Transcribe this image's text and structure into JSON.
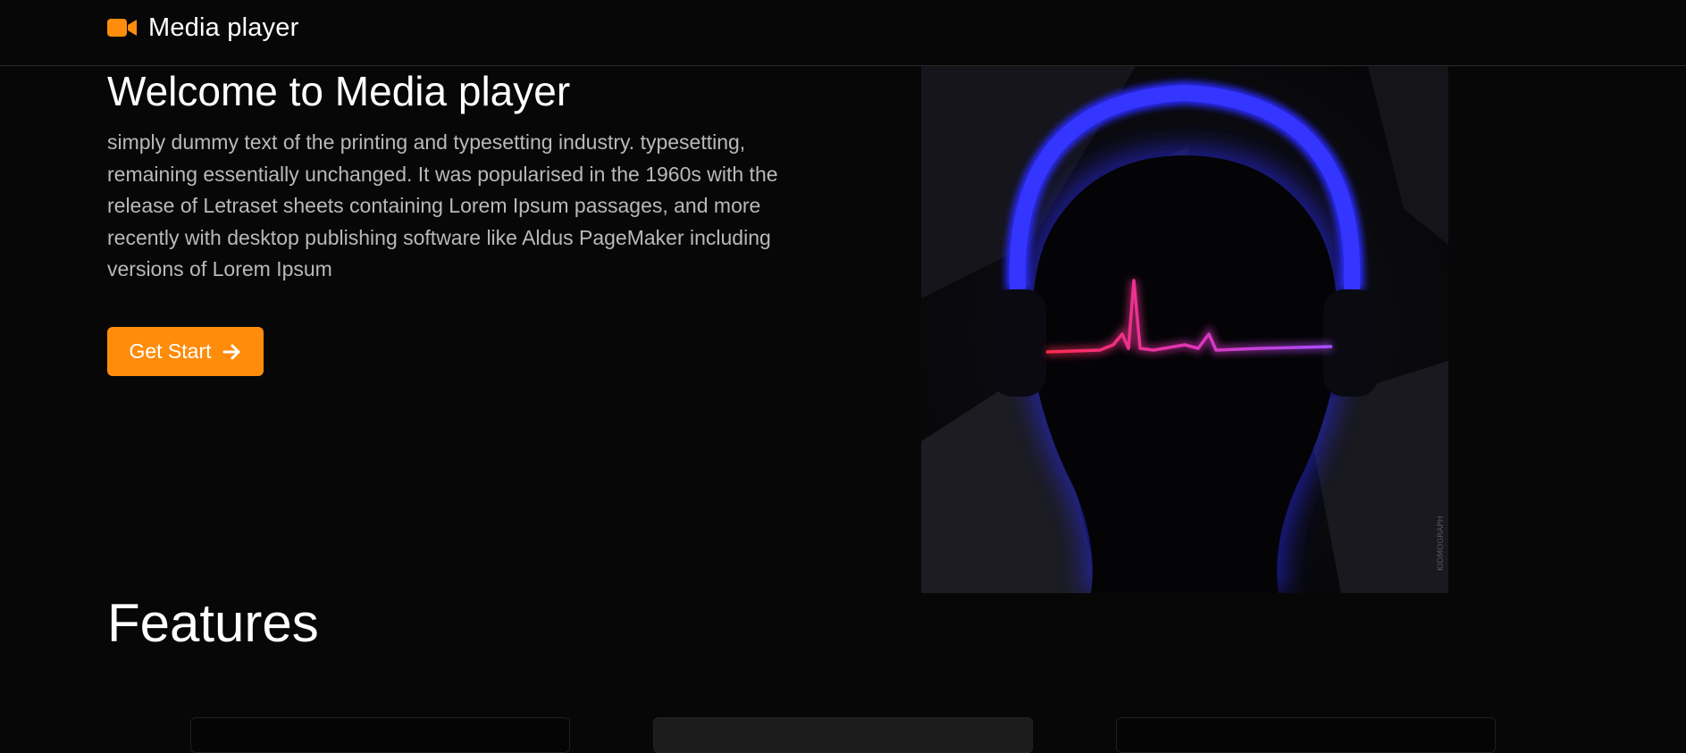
{
  "navbar": {
    "brand_text": "Media player",
    "brand_icon": "video-camera-icon"
  },
  "hero": {
    "title": "Welcome to Media player",
    "description": "simply dummy text of the printing and typesetting industry. typesetting, remaining essentially unchanged. It was popularised in the 1960s with the release of Letraset sheets containing Lorem Ipsum passages, and more recently with desktop publishing software like Aldus PageMaker including versions of Lorem Ipsum",
    "cta_label": "Get Start",
    "cta_icon": "arrow-right-icon",
    "image_watermark": "KIDMOGRAPH"
  },
  "features": {
    "title": "Features",
    "cards": [
      {
        "name": "feature-card-1"
      },
      {
        "name": "feature-card-2"
      },
      {
        "name": "feature-card-3"
      }
    ]
  },
  "colors": {
    "background": "#070707",
    "accent": "#ff8c0a",
    "text_primary": "#ffffff",
    "text_muted": "#b9b9b9",
    "headphone_glow": "#2a2cff",
    "pulse_start": "#ff2a4d",
    "pulse_end": "#a84dff"
  }
}
